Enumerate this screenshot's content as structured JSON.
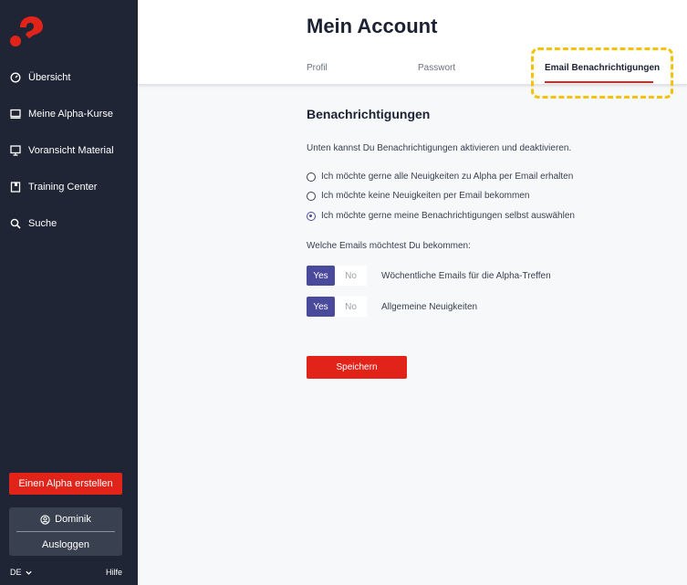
{
  "sidebar": {
    "logo": "alpha-logo",
    "items": [
      {
        "label": "Übersicht",
        "icon": "gauge-icon"
      },
      {
        "label": "Meine Alpha-Kurse",
        "icon": "monitor-icon"
      },
      {
        "label": "Voransicht Material",
        "icon": "screen-icon"
      },
      {
        "label": "Training Center",
        "icon": "book-icon"
      },
      {
        "label": "Suche",
        "icon": "search-icon"
      }
    ],
    "create_button": "Einen Alpha erstellen",
    "user_name": "Dominik",
    "logout": "Ausloggen",
    "language": "DE",
    "help": "Hilfe"
  },
  "header": {
    "title": "Mein Account",
    "tabs": [
      {
        "label": "Profil"
      },
      {
        "label": "Passwort"
      },
      {
        "label": "Email Benachrichtigungen",
        "active": true
      }
    ]
  },
  "content": {
    "section_title": "Benachrichtigungen",
    "info_text": "Unten kannst Du Benachrichtigungen aktivieren und deaktivieren.",
    "radio_options": [
      {
        "label": "Ich möchte gerne alle Neuigkeiten zu Alpha per Email erhalten",
        "checked": false
      },
      {
        "label": "Ich möchte keine Neuigkeiten per Email bekommen",
        "checked": false
      },
      {
        "label": "Ich möchte gerne meine Benachrichtigungen selbst auswählen",
        "checked": true
      }
    ],
    "question": "Welche Emails möchtest Du bekommen:",
    "toggles": [
      {
        "yes": "Yes",
        "no": "No",
        "label": "Wöchentliche Emails für die Alpha-Treffen",
        "selected": "Yes"
      },
      {
        "yes": "Yes",
        "no": "No",
        "label": "Allgemeine Neuigkeiten",
        "selected": "Yes"
      }
    ],
    "save_button": "Speichern"
  },
  "colors": {
    "sidebar_bg": "#1f2534",
    "accent_red": "#e2231a",
    "toggle_yes": "#4a4a9c",
    "highlight": "#f4c20d"
  }
}
